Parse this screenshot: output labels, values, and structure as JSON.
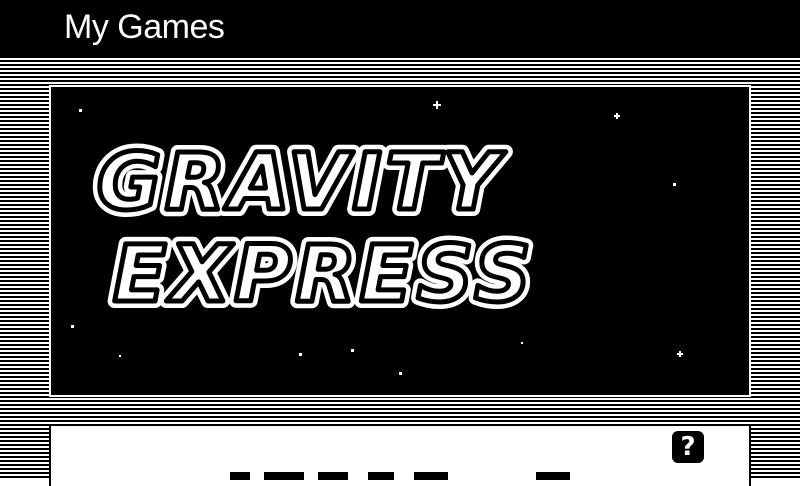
{
  "header": {
    "title": "My Games"
  },
  "featured_game": {
    "logo_line1": "GRAVITY",
    "logo_line2": "EXPRESS"
  },
  "next_card": {
    "help_icon": "question-mark-icon",
    "help_glyph": "?"
  }
}
